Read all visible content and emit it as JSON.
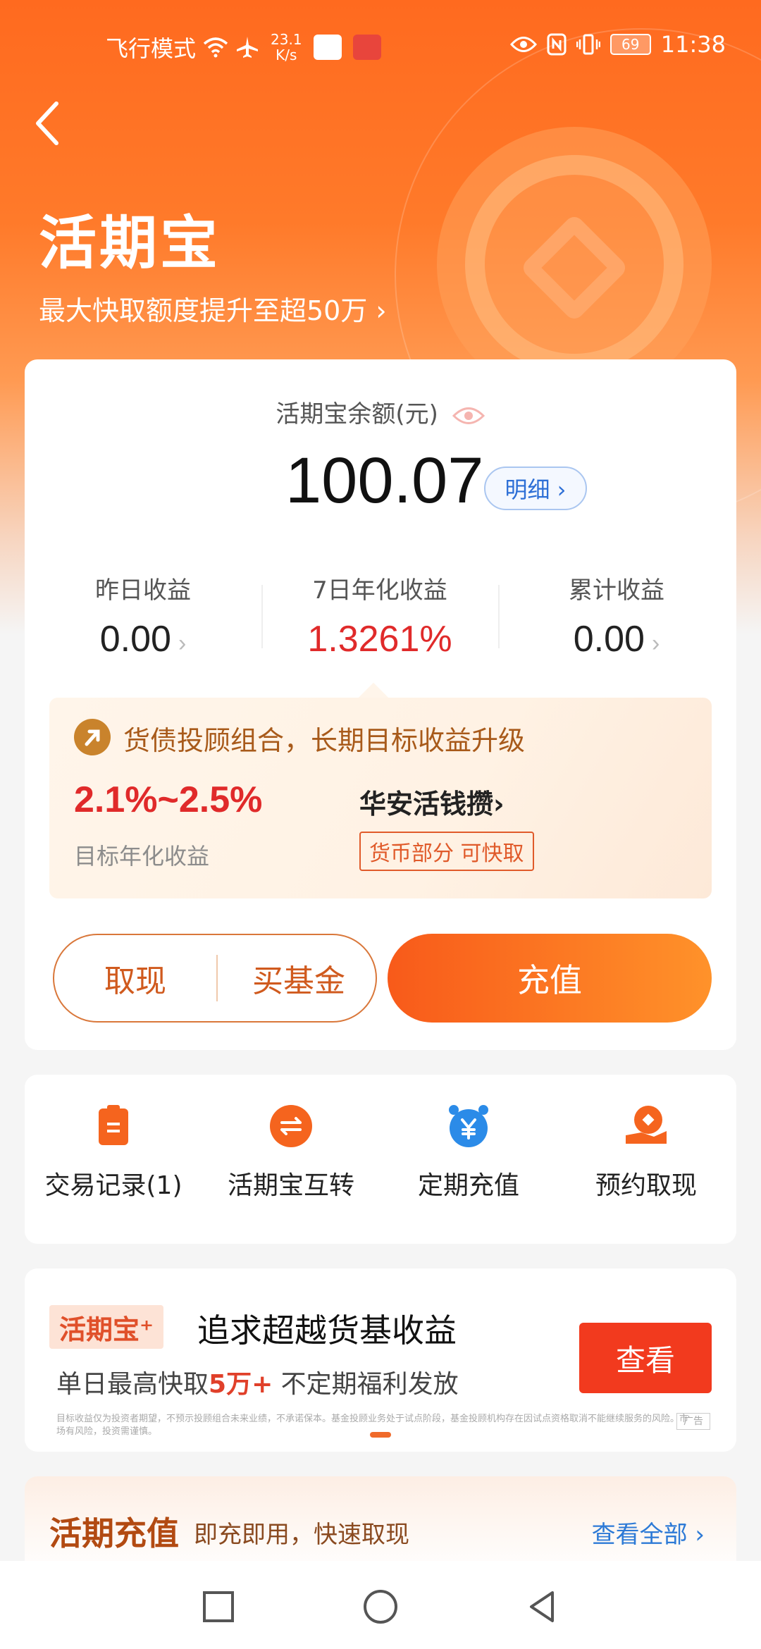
{
  "status_bar": {
    "left_text": "飞行模式",
    "speed_top": "23.1",
    "speed_bottom": "K/s",
    "battery": "69",
    "time": "11:38"
  },
  "header": {
    "title": "活期宝",
    "subtitle": "最大快取额度提升至超50万 ›"
  },
  "balance": {
    "label": "活期宝余额(元)",
    "amount": "100.07",
    "detail_label": "明细 ›"
  },
  "stats": [
    {
      "label": "昨日收益",
      "value": "0.00",
      "chev": "›"
    },
    {
      "label": "7日年化收益",
      "value": "1.3261%"
    },
    {
      "label": "累计收益",
      "value": "0.00",
      "chev": "›"
    }
  ],
  "promo": {
    "headline": "货债投顾组合，长期目标收益升级",
    "rate": "2.1%~2.5%",
    "rate_label": "目标年化收益",
    "fund_name": "华安活钱攒›",
    "tag": "货币部分 可快取"
  },
  "buttons": {
    "withdraw": "取现",
    "buy_fund": "买基金",
    "charge": "充值"
  },
  "actions": [
    {
      "label": "交易记录(1)",
      "icon": "clipboard-icon",
      "color": "#f5641e"
    },
    {
      "label": "活期宝互转",
      "icon": "swap-icon",
      "color": "#f5641e"
    },
    {
      "label": "定期充值",
      "icon": "alarm-yen-icon",
      "color": "#2b8be8"
    },
    {
      "label": "预约取现",
      "icon": "hand-coin-icon",
      "color": "#f5641e"
    }
  ],
  "ad": {
    "badge": "活期宝⁺",
    "title": "追求超越货基收益",
    "sub_prefix": "单日最高快取",
    "sub_highlight": "5万+",
    "sub_suffix": "  不定期福利发放",
    "button": "查看",
    "fine_print": "目标收益仅为投资者期望，不预示投顾组合未来业绩，不承诺保本。基金投顾业务处于试点阶段，基金投顾机构存在因试点资格取消不能继续服务的风险。市场有风险，投资需谨慎。",
    "ad_tag": "广告"
  },
  "bottom_card": {
    "title": "活期充值",
    "subtitle": "即充即用，快速取现",
    "view_all": "查看全部 ›"
  },
  "colors": {
    "brand_orange": "#ff6a1f",
    "rate_red": "#e02a2a",
    "link_blue": "#2d6fd6"
  }
}
